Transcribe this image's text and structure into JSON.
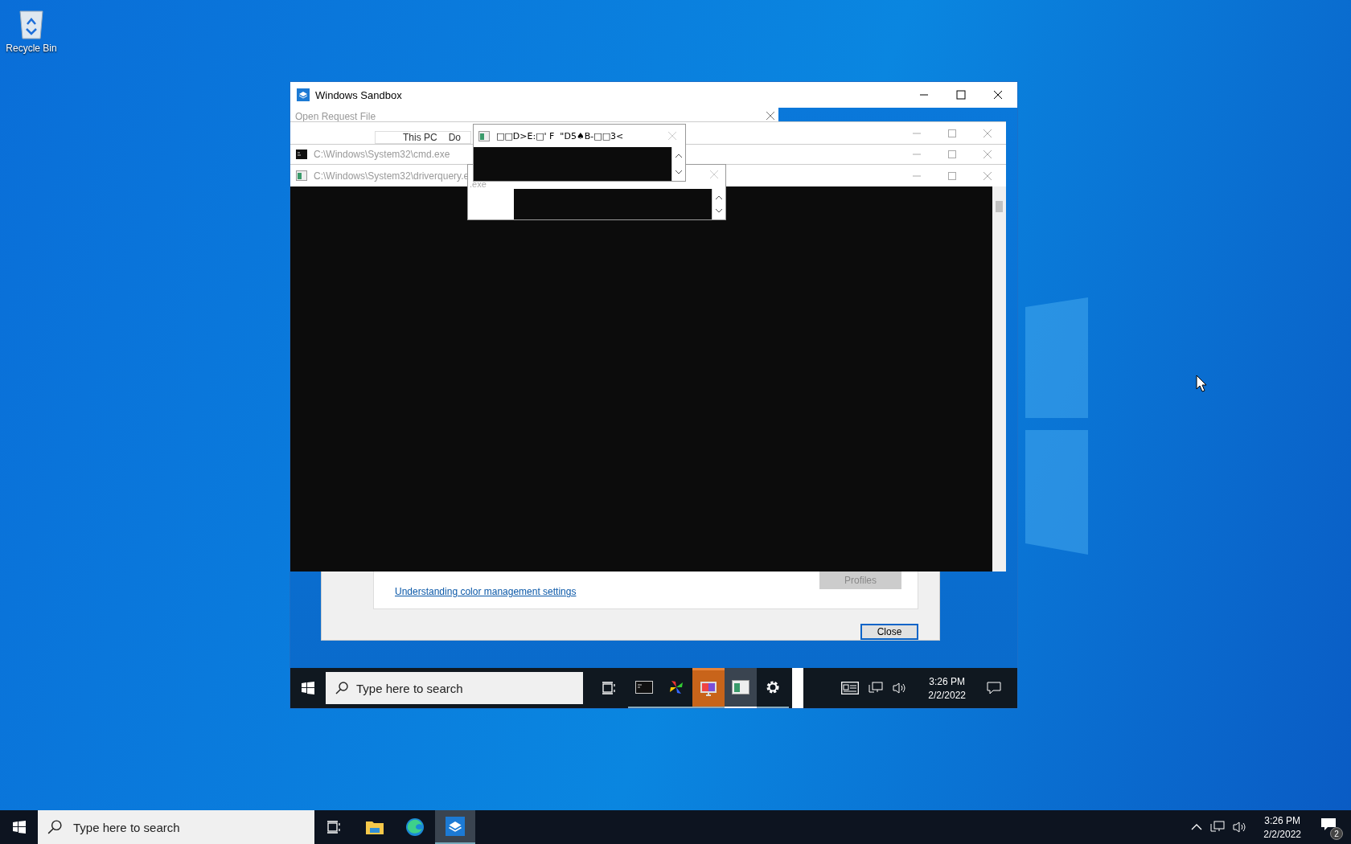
{
  "desktop": {
    "icons": [
      {
        "label": "Recycle Bin"
      }
    ]
  },
  "sandbox_window": {
    "title": "Windows Sandbox",
    "open_request_dialog": {
      "title": "Open Request File",
      "breadcrumb": [
        "This PC",
        "Do"
      ]
    },
    "cmd_window": {
      "title": "C:\\Windows\\System32\\cmd.exe"
    },
    "driverquery_window": {
      "title": "C:\\Windows\\System32\\driverquery.e"
    },
    "garbled_window": {
      "title": "□□D>E:□' F  \"D5♠B-□□3<"
    },
    "blank_window": {
      "title_fragment": ".exe"
    },
    "color_dialog": {
      "link": "Understanding color management settings",
      "profiles_button": {
        "label": "Profiles",
        "disabled": true
      },
      "close_button": "Close"
    },
    "taskbar": {
      "search_placeholder": "Type here to search",
      "apps": [
        {
          "kind": "cmd",
          "selected": false,
          "flashing": false
        },
        {
          "kind": "pinwheel",
          "selected": false,
          "flashing": false
        },
        {
          "kind": "monitor",
          "selected": false,
          "flashing": true
        },
        {
          "kind": "window",
          "selected": true,
          "flashing": false
        },
        {
          "kind": "gear",
          "selected": false,
          "flashing": false
        }
      ],
      "time": "3:26 PM",
      "date": "2/2/2022"
    }
  },
  "taskbar": {
    "search_placeholder": "Type here to search",
    "apps": [
      {
        "kind": "explorer",
        "selected": false
      },
      {
        "kind": "edge",
        "selected": false
      },
      {
        "kind": "sandbox",
        "selected": true
      }
    ],
    "time": "3:26 PM",
    "date": "2/2/2022",
    "notification_count": "2"
  }
}
